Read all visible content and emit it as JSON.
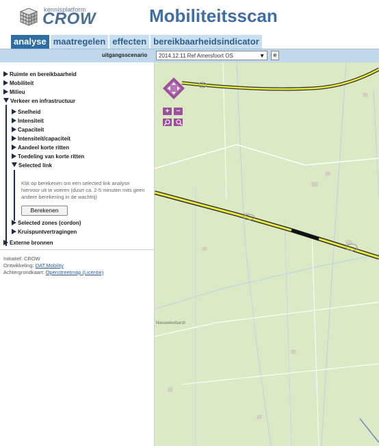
{
  "header": {
    "logo_small": "kennisplatform",
    "logo_big": "CROW",
    "title": "Mobiliteitsscan"
  },
  "tabs": [
    {
      "label": "analyse",
      "active": true
    },
    {
      "label": "maatregelen",
      "active": false
    },
    {
      "label": "effecten",
      "active": false
    },
    {
      "label": "bereikbaarheidsindicator",
      "active": false
    }
  ],
  "scenario": {
    "label": "uitgangsscenario",
    "value": "2014.12.11 Ref Amersfoort OS",
    "arrow": "▼",
    "button": "e"
  },
  "tree": {
    "ruimte": "Ruimte en bereikbaarheid",
    "mobiliteit": "Mobiliteit",
    "milieu": "Milieu",
    "verkeer": "Verkeer en infrastructuur",
    "snelheid": "Snelheid",
    "intensiteit": "Intensiteit",
    "capaciteit": "Capaciteit",
    "ic": "Intensiteit/capaciteit",
    "aandeel": "Aandeel korte ritten",
    "toedeling": "Toedeling van korte ritten",
    "selected_link": "Selected link",
    "info": "Klik op berekenen om een selected link analyse hiervoor uit te voeren (duurt ca. 2-5 minuten mits geen andere berekening in de wachtrij)",
    "calc_button": "Berekenen",
    "selected_zones": "Selected zones (cordon)",
    "kruispunt": "Kruispuntvertragingen",
    "externe": "Externe bronnen"
  },
  "credits": {
    "initiatief": "Initiatief: CROW",
    "ontwikkeling_label": "Ontwikkeling:",
    "ontwikkeling_link": "DAT.Mobility",
    "achtergrond_label": "Achtergrondkaart:",
    "achtergrond_link": "Openstreetmap (Licentie)"
  },
  "map": {
    "place_label": "Nieuwekerburch",
    "road_color": "#e8e83a",
    "background_color": "#dbe9c4",
    "accent_color": "#9c4f9a"
  }
}
